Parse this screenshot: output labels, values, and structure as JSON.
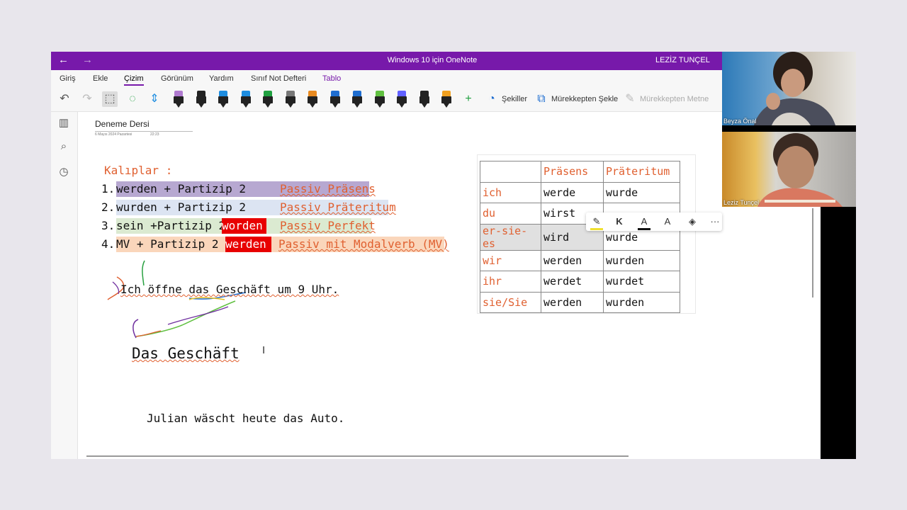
{
  "window": {
    "title": "Windows 10 için OneNote",
    "user": "LEZİZ TUNÇEL",
    "back_icon": "←",
    "forward_icon": "→"
  },
  "menu": {
    "items": [
      "Giriş",
      "Ekle",
      "Çizim",
      "Görünüm",
      "Yardım",
      "Sınıf Not Defteri",
      "Tablo"
    ],
    "active": "Çizim"
  },
  "toolbar": {
    "shapes_label": "Şekiller",
    "ink_to_shape_label": "Mürekkepten Şekle",
    "ink_to_text_label": "Mürekkepten Metne",
    "pen_colors": [
      "#b07ad0",
      "#222222",
      "#1e8de0",
      "#1e8de0",
      "#20a040",
      "#777777",
      "#e88a20",
      "#1e6dd0",
      "#1e6dd0",
      "#60c040",
      "#6060ff",
      "#222222",
      "#f0a020"
    ]
  },
  "page": {
    "title": "Deneme Dersi",
    "date": "6 Mayıs 2024 Pazartesi",
    "time": "22:23"
  },
  "notes": {
    "heading": "Kalıplar :",
    "rows": [
      {
        "num": "1.",
        "pattern": "werden + Partizip 2",
        "passiv": "Passiv Präsens"
      },
      {
        "num": "2.",
        "pattern": "wurden + Partizip 2",
        "passiv": "Passiv Präteritum"
      },
      {
        "num": "3.",
        "pattern": "sein +Partizip 2+ ",
        "red": "worden",
        "passiv": "Passiv Perfekt"
      },
      {
        "num": "4.",
        "pattern": "MV + Partizip 2 + ",
        "red": "werden",
        "passiv": "Passiv mit Modalverb (MV)"
      }
    ],
    "sentence1": "Ich öffne das Geschäft  um 9 Uhr.",
    "sentence2": "Das Geschäft",
    "sentence3": "Julian wäscht heute das Auto."
  },
  "table": {
    "headers": [
      "",
      "Präsens",
      "Präteritum"
    ],
    "rows": [
      [
        "ich",
        "werde",
        "wurde"
      ],
      [
        "du",
        "wirst",
        ""
      ],
      [
        "er-sie-es",
        "wird",
        "wurde"
      ],
      [
        "wir",
        "werden",
        "wurden"
      ],
      [
        "ihr",
        "werdet",
        "wurdet"
      ],
      [
        "sie/Sie",
        "werden",
        "wurden"
      ]
    ]
  },
  "floatbar": {
    "bold_label": "K",
    "font_color_label": "A",
    "font_size_label": "A",
    "more_label": "···"
  },
  "participants": [
    {
      "name": "Beyza Önal"
    },
    {
      "name": "Leziz Tunçel"
    }
  ]
}
